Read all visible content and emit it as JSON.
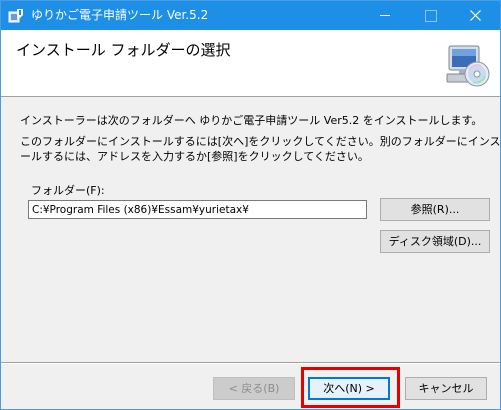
{
  "window": {
    "title": "ゆりかご電子申請ツール Ver.5.2",
    "accent_color": "#1e8fe6"
  },
  "banner": {
    "heading": "インストール フォルダーの選択",
    "icon": "setup-disc-computer-icon"
  },
  "body": {
    "intro": "インストーラーは次のフォルダーへ ゆりかご電子申請ツール Ver5.2 をインストールします。",
    "instruction_line1": "このフォルダーにインストールするには[次へ]をクリックしてください。別のフォルダーにインスト",
    "instruction_line2": "ールするには、アドレスを入力するか[参照]をクリックしてください。"
  },
  "folder": {
    "label": "フォルダー(F):",
    "value": "C:¥Program Files (x86)¥Essam¥yurietax¥"
  },
  "buttons": {
    "browse": "参照(R)...",
    "disk_space": "ディスク領域(D)...",
    "back": "< 戻る(B)",
    "next": "次へ(N) >",
    "cancel": "キャンセル"
  },
  "highlight_color": "#e60000"
}
